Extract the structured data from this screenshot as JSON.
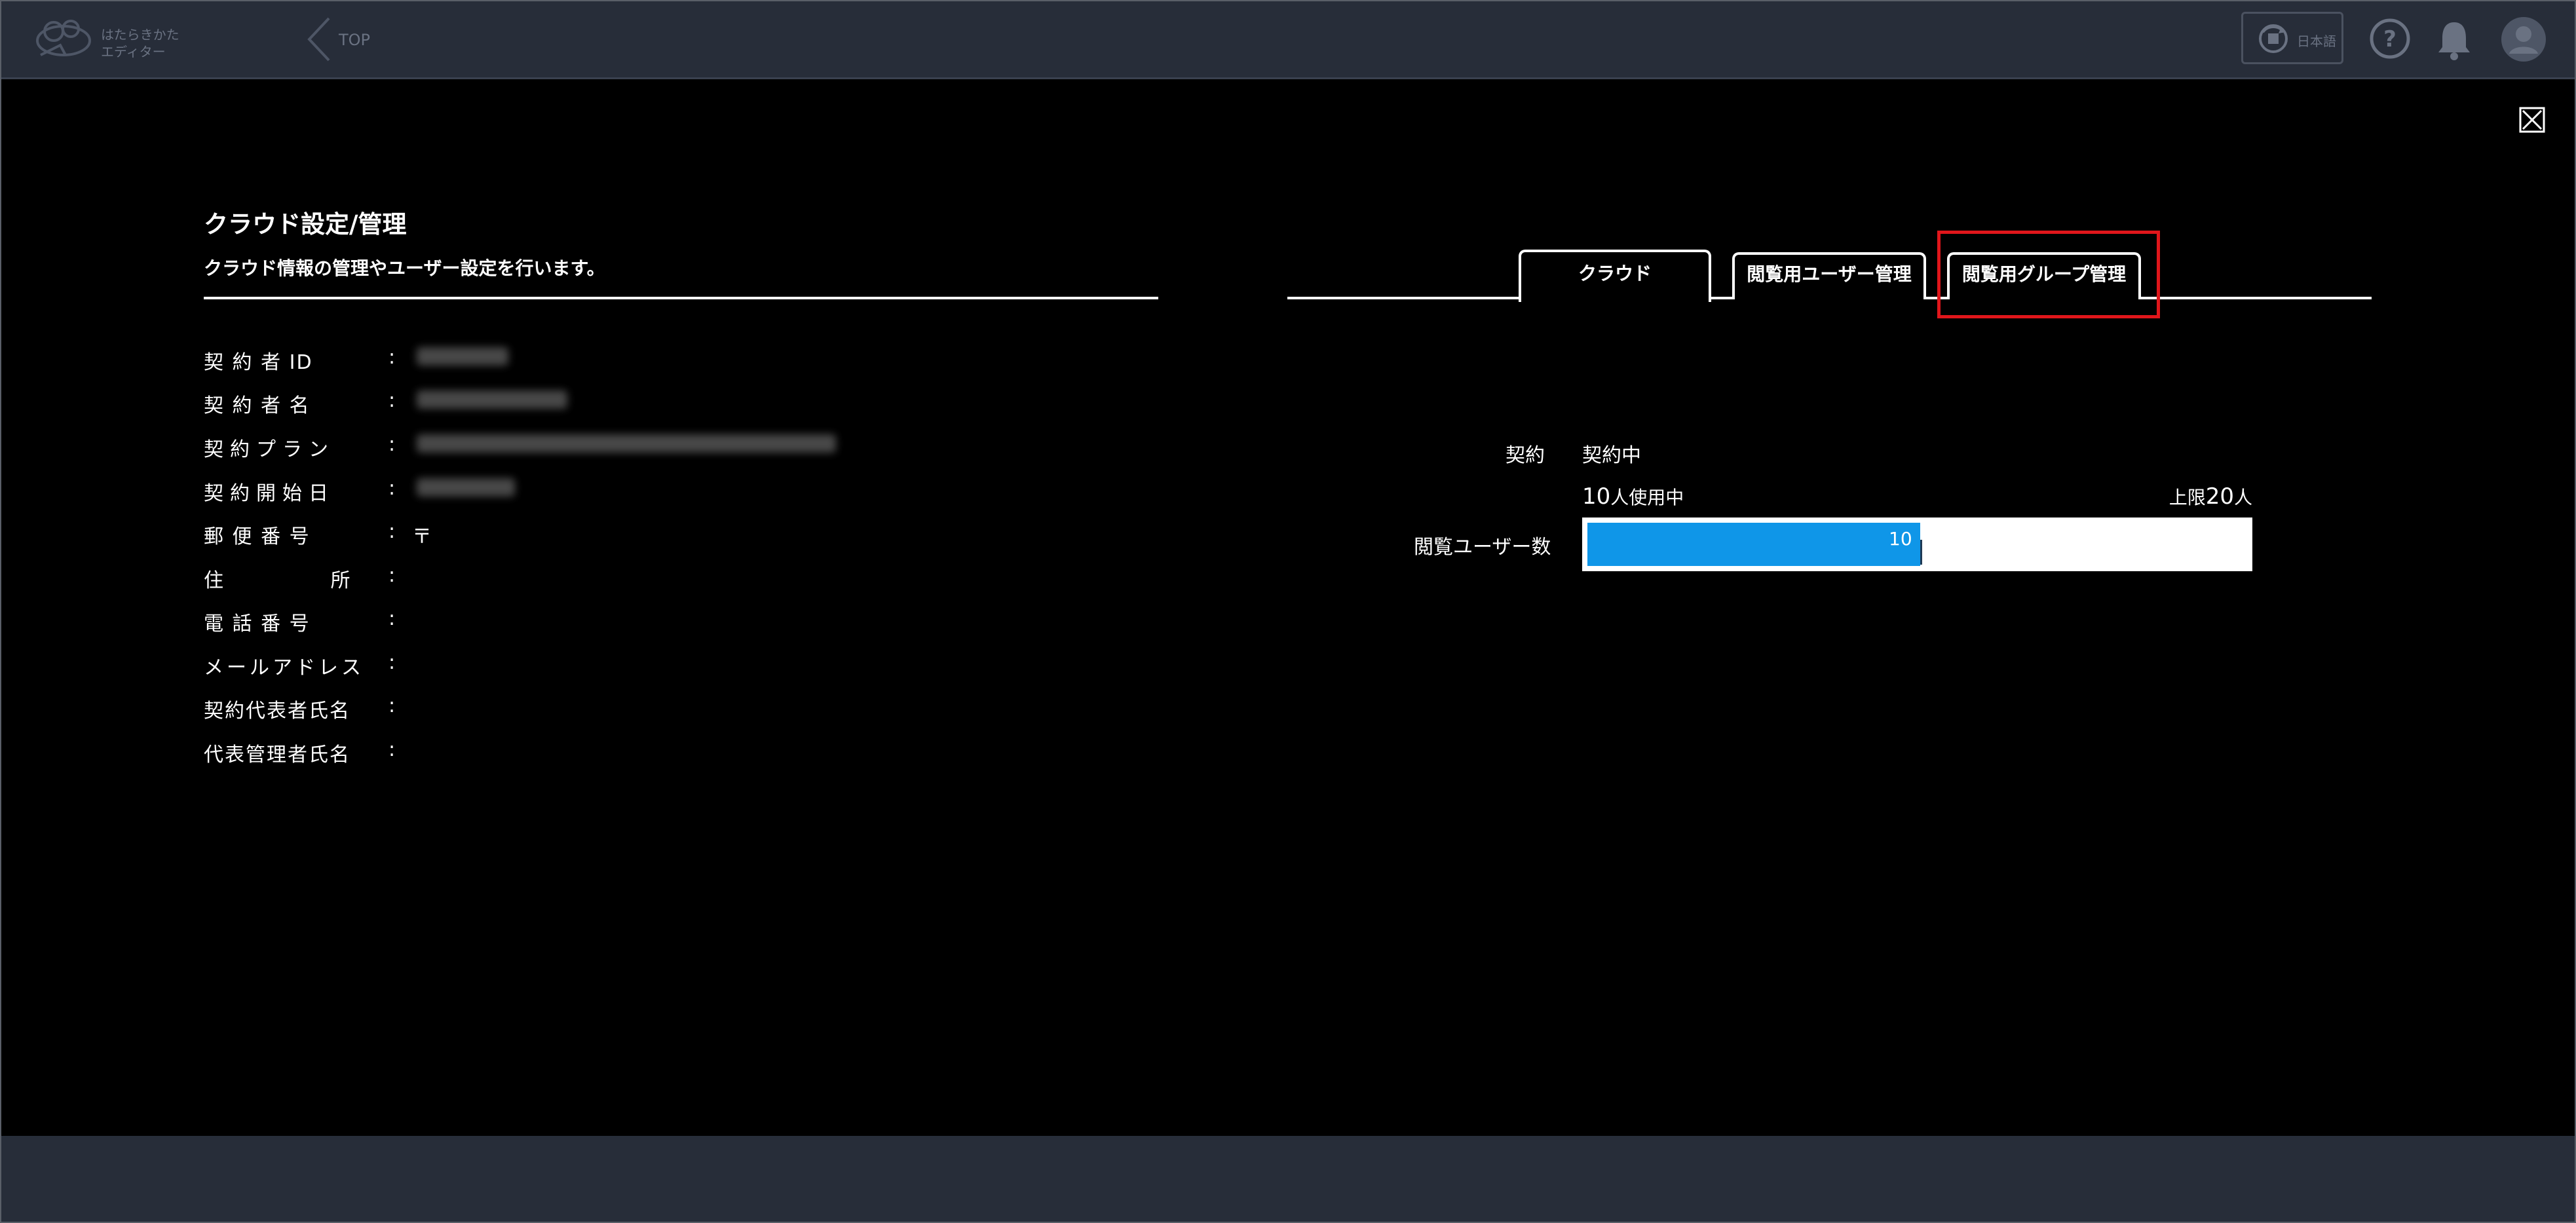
{
  "header": {
    "logo_text_line1": "はたらきかた",
    "logo_text_line2": "エディター",
    "back_label": "TOP",
    "language_label": "日本語"
  },
  "page": {
    "title": "クラウド設定/管理",
    "subtitle": "クラウド情報の管理やユーザー設定を行います。"
  },
  "info": {
    "contractor_id_label": "契 約 者 ID",
    "contractor_name_label": "契 約 者 名",
    "plan_label": "契約プラン",
    "start_date_label": "契約開始日",
    "postal_label": "郵 便 番 号",
    "postal_value": "〒",
    "address_label": "住 所",
    "phone_label": "電 話 番 号",
    "email_label": "メールアドレス",
    "rep_name_label": "契約代表者氏名",
    "admin_name_label": "代表管理者氏名",
    "colon": ":"
  },
  "tabs": {
    "cloud": "クラウド",
    "viewer_users": "閲覧用ユーザー管理",
    "viewer_groups": "閲覧用グループ管理"
  },
  "contract": {
    "label": "契約",
    "status": "契約中",
    "used_count": "10",
    "used_suffix": "人使用中",
    "limit_prefix": "上限",
    "limit_count": "20",
    "limit_suffix": "人",
    "viewer_label": "閲覧ユーザー数",
    "progress_value": "10",
    "progress_fraction": 0.5
  },
  "colors": {
    "accent": "#0f96e8",
    "highlight": "#e0161b",
    "topbar": "#272d39"
  }
}
